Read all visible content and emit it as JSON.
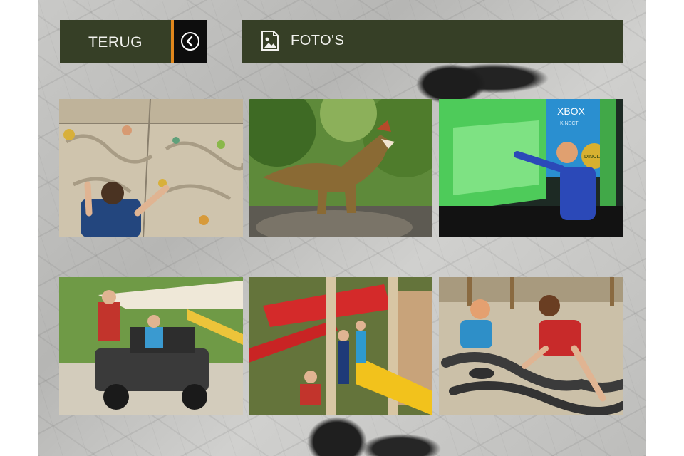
{
  "header": {
    "back_label": "TERUG",
    "title": "FOTO'S"
  },
  "gallery": {
    "photos": [
      {
        "subject": "child on climbing wall"
      },
      {
        "subject": "dinosaur statue"
      },
      {
        "subject": "child playing Xbox Kinect",
        "wall_text": "XBOX",
        "wall_subtext": "KINECT",
        "logo_text": "DINOLAND"
      },
      {
        "subject": "children on jeep"
      },
      {
        "subject": "children at red plane play structure"
      },
      {
        "subject": "children digging fossils in sand"
      }
    ]
  },
  "colors": {
    "header_bg": "#363f26",
    "accent": "#e0861c"
  },
  "icons": [
    "back-arrow-icon",
    "photo-icon"
  ]
}
